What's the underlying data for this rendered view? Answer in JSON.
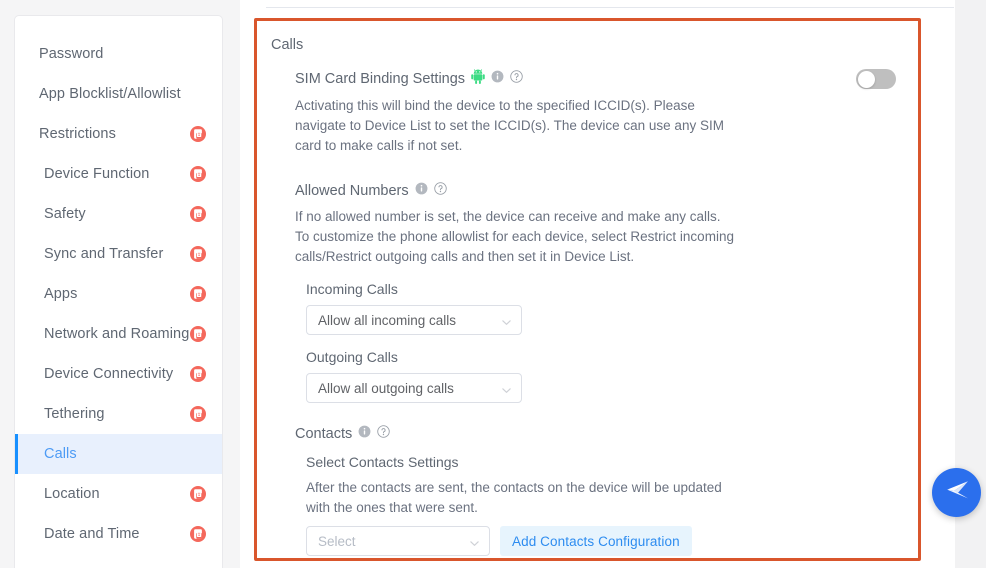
{
  "colors": {
    "accent_border": "#d9562c",
    "active_nav_bg": "#e8f0fd",
    "active_nav_bar": "#1890ff",
    "active_nav_text": "#4d9bf5",
    "lock_badge": "#f4685c",
    "link_blue": "#2d8cf0",
    "button_bg": "#e7f4fd",
    "fab_blue": "#2b6fed",
    "android_green": "#3ddc84",
    "toggle_off": "#bfbfbf",
    "text": "#5f6772"
  },
  "sidebar": {
    "items": [
      {
        "label": "Password",
        "level": 0,
        "locked": false,
        "active": false
      },
      {
        "label": "App Blocklist/Allowlist",
        "level": 0,
        "locked": false,
        "active": false
      },
      {
        "label": "Restrictions",
        "level": 0,
        "locked": true,
        "active": false
      },
      {
        "label": "Device Function",
        "level": 1,
        "locked": true,
        "active": false
      },
      {
        "label": "Safety",
        "level": 1,
        "locked": true,
        "active": false
      },
      {
        "label": "Sync and Transfer",
        "level": 1,
        "locked": true,
        "active": false
      },
      {
        "label": "Apps",
        "level": 1,
        "locked": true,
        "active": false
      },
      {
        "label": "Network and Roaming",
        "level": 1,
        "locked": true,
        "active": false
      },
      {
        "label": "Device Connectivity",
        "level": 1,
        "locked": true,
        "active": false
      },
      {
        "label": "Tethering",
        "level": 1,
        "locked": true,
        "active": false
      },
      {
        "label": "Calls",
        "level": 1,
        "locked": false,
        "active": true
      },
      {
        "label": "Location",
        "level": 1,
        "locked": true,
        "active": false
      },
      {
        "label": "Date and Time",
        "level": 1,
        "locked": true,
        "active": false
      }
    ]
  },
  "panel": {
    "title": "Calls",
    "sim_binding": {
      "label": "SIM Card Binding Settings",
      "platform_icon": "android-icon",
      "info_icon": "info-icon",
      "help_icon": "help-icon",
      "description": "Activating this will bind the device to the specified ICCID(s). Please navigate to Device List to set the ICCID(s). The device can use any SIM card to make calls if not set.",
      "toggle_state": "off"
    },
    "allowed_numbers": {
      "label": "Allowed Numbers",
      "info_icon": "info-icon",
      "help_icon": "help-icon",
      "description": "If no allowed number is set, the device can receive and make any calls. To customize the phone allowlist for each device, select Restrict incoming calls/Restrict outgoing calls and then set it in Device List.",
      "incoming": {
        "label": "Incoming Calls",
        "value": "Allow all incoming calls"
      },
      "outgoing": {
        "label": "Outgoing Calls",
        "value": "Allow all outgoing calls"
      }
    },
    "contacts": {
      "label": "Contacts",
      "info_icon": "info-icon",
      "help_icon": "help-icon",
      "sub_label": "Select Contacts Settings",
      "description": "After the contacts are sent, the contacts on the device will be updated with the ones that were sent.",
      "select_placeholder": "Select",
      "select_value": "",
      "add_button_label": "Add Contacts Configuration"
    }
  },
  "fab": {
    "icon": "send-arrow-icon",
    "label": "Send"
  }
}
